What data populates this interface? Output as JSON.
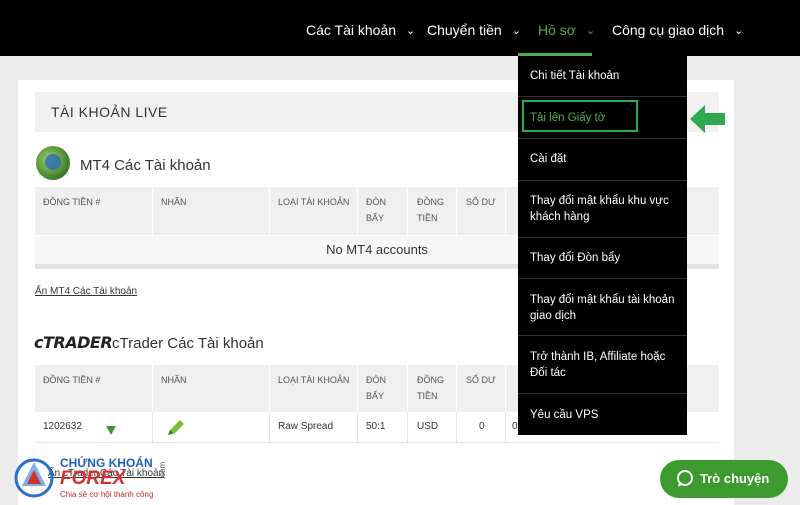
{
  "nav": {
    "items": [
      "Các Tài khoản",
      "Chuyển tiền",
      "Hồ sơ",
      "Công cụ giao dịch"
    ]
  },
  "live": {
    "title": "TÀI KHOẢN LIVE"
  },
  "mt4": {
    "title": "MT4 Các Tài khoản",
    "headers": [
      "ĐỒNG TIỀN #",
      "NHÃN",
      "LOẠI TÀI KHOẢN",
      "ĐÒN BẨY",
      "ĐỒNG TIỀN",
      "SỐ DƯ"
    ],
    "empty": "No MT4 accounts",
    "hide_link": "Ẩn MT4 Các Tài khoản"
  },
  "ctrader": {
    "logo": "cTRADER",
    "title": "cTrader Các Tài khoản",
    "headers": [
      "ĐỒNG TIỀN #",
      "NHÃN",
      "LOẠI TÀI KHOẢN",
      "ĐÒN BẨY",
      "ĐỒNG TIỀN",
      "SỐ DƯ"
    ],
    "row": {
      "account": "1202632",
      "type": "Raw Spread",
      "leverage": "50:1",
      "currency": "USD",
      "balance": "0",
      "extra": "0"
    },
    "hide_link": "Ẩn cTrader Các Tài khoản"
  },
  "menu": {
    "items": [
      "Chi tiết Tài khoản",
      "Tải lên Giấy tờ",
      "Cài đặt",
      "Thay đổi mật khẩu khu vực khách hàng",
      "Thay đổi Đòn bẩy",
      "Thay đổi mật khẩu tài khoản giao dịch",
      "Trở thành IB, Affiliate hoặc Đối tác",
      "Yêu cầu VPS"
    ]
  },
  "chat": {
    "label": "Trò chuyện"
  },
  "watermark": {
    "line1": "CHỨNG KHOÁN",
    "line2": "FOREX",
    "line3": "Chia sẻ cơ hội thành công",
    "dotcom": ".com"
  },
  "colors": {
    "accent": "#4caf50",
    "chat": "#3d9a2f",
    "menu_bg": "#000000"
  }
}
